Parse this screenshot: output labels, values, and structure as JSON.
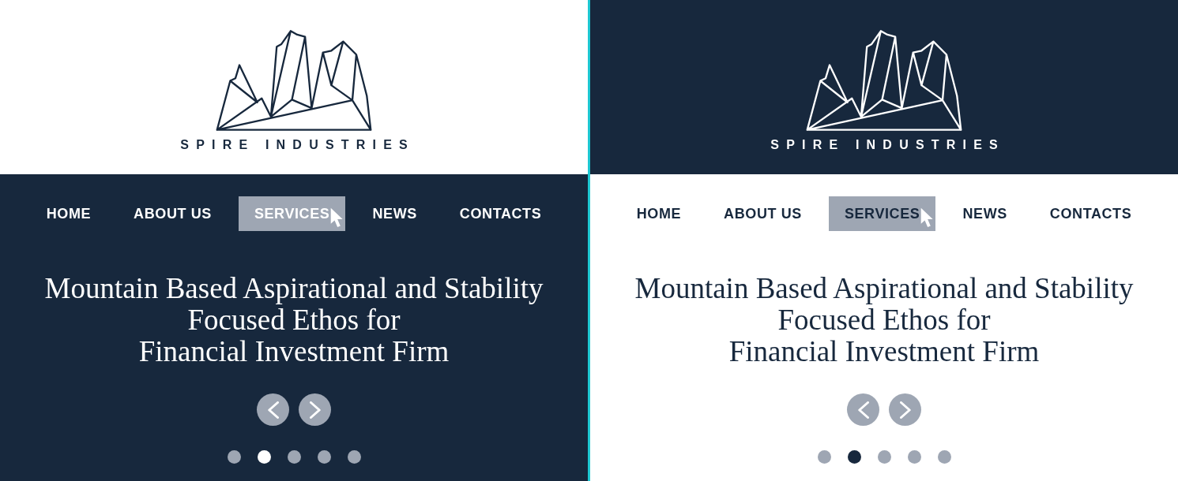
{
  "panels": [
    {
      "kind": "dark",
      "logo": {
        "text": "SPIRE INDUSTRIES"
      },
      "nav": [
        {
          "label": "HOME",
          "selected": false,
          "hovered": false
        },
        {
          "label": "ABOUT US",
          "selected": false,
          "hovered": false
        },
        {
          "label": "SERVICES",
          "selected": true,
          "hovered": true
        },
        {
          "label": "NEWS",
          "selected": false,
          "hovered": false
        },
        {
          "label": "CONTACTS",
          "selected": false,
          "hovered": false
        }
      ],
      "headline": [
        "Mountain Based Aspirational and Stability",
        "Focused Ethos for",
        "Financial Investment Firm"
      ],
      "dots": [
        {
          "selected": false
        },
        {
          "selected": true
        },
        {
          "selected": false
        },
        {
          "selected": false
        },
        {
          "selected": false
        }
      ]
    },
    {
      "kind": "light",
      "logo": {
        "text": "SPIRE INDUSTRIES"
      },
      "nav": [
        {
          "label": "HOME",
          "selected": false,
          "hovered": false
        },
        {
          "label": "ABOUT US",
          "selected": false,
          "hovered": false
        },
        {
          "label": "SERVICES",
          "selected": true,
          "hovered": true
        },
        {
          "label": "NEWS",
          "selected": false,
          "hovered": false
        },
        {
          "label": "CONTACTS",
          "selected": false,
          "hovered": false
        }
      ],
      "headline": [
        "Mountain Based Aspirational and Stability",
        "Focused Ethos for",
        "Financial Investment Firm"
      ],
      "dots": [
        {
          "selected": false
        },
        {
          "selected": true
        },
        {
          "selected": false
        },
        {
          "selected": false
        },
        {
          "selected": false
        }
      ]
    }
  ]
}
